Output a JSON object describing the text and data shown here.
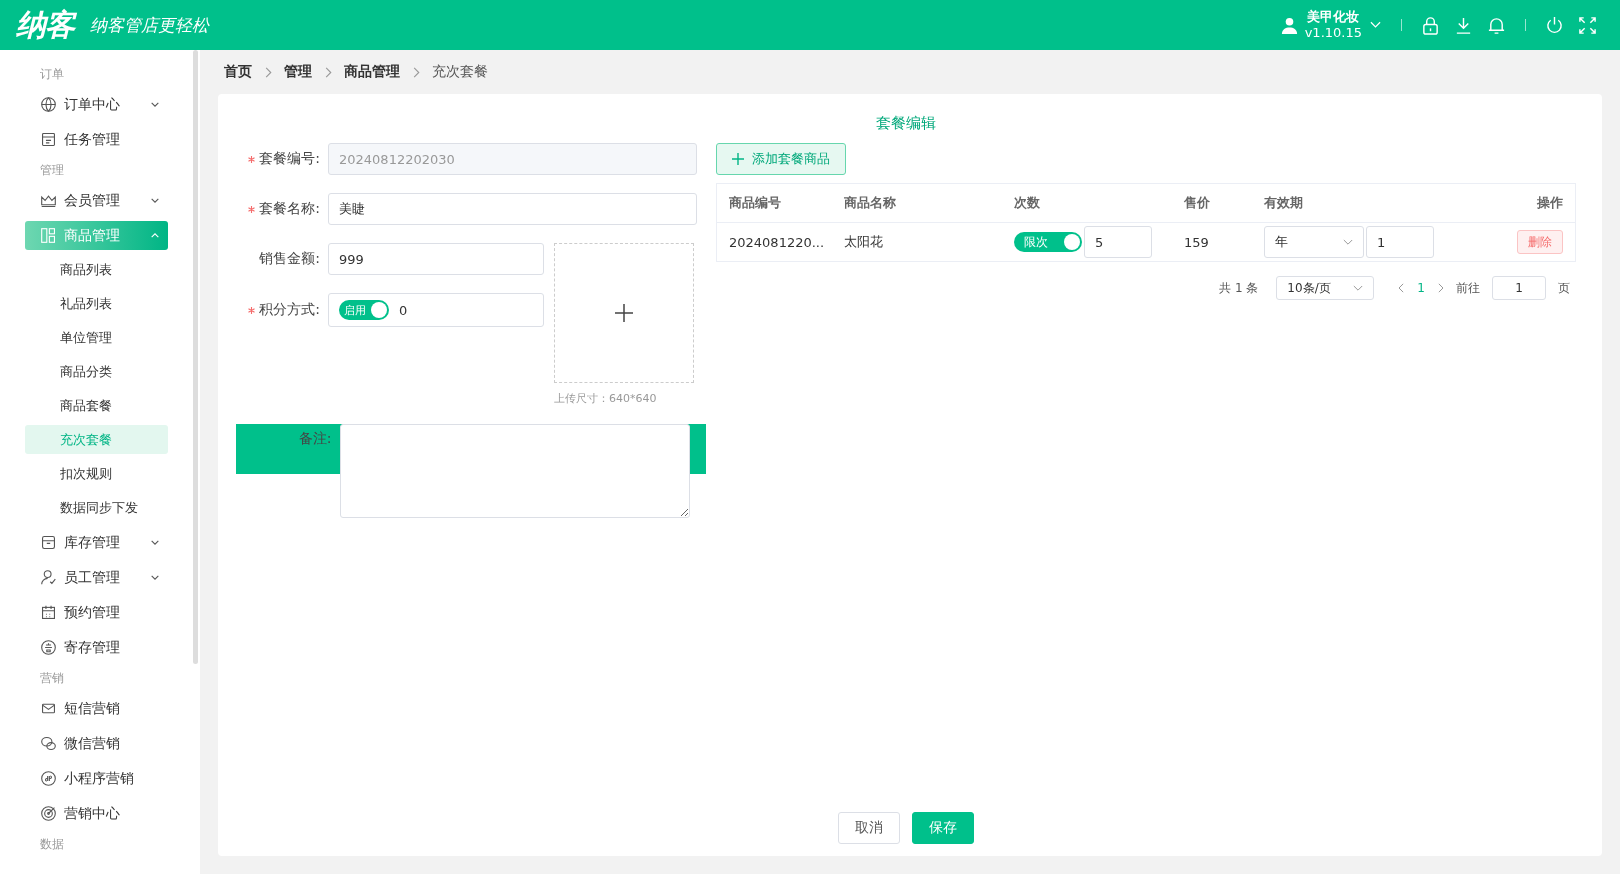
{
  "header": {
    "logo": "纳客",
    "slogan": "纳客管店更轻松",
    "user": "美甲化妆",
    "version": "v1.10.15"
  },
  "sidebar": {
    "sections": [
      {
        "label": "订单",
        "items": [
          {
            "label": "订单中心",
            "expanded": false,
            "selected": false
          },
          {
            "label": "任务管理",
            "selected": false
          }
        ]
      },
      {
        "label": "管理",
        "items": [
          {
            "label": "会员管理",
            "expanded": false,
            "selected": false
          },
          {
            "label": "商品管理",
            "expanded": true,
            "selected": true,
            "children": [
              {
                "label": "商品列表",
                "selected": false
              },
              {
                "label": "礼品列表",
                "selected": false
              },
              {
                "label": "单位管理",
                "selected": false
              },
              {
                "label": "商品分类",
                "selected": false
              },
              {
                "label": "商品套餐",
                "selected": false
              },
              {
                "label": "充次套餐",
                "selected": true
              },
              {
                "label": "扣次规则",
                "selected": false
              },
              {
                "label": "数据同步下发",
                "selected": false
              }
            ]
          },
          {
            "label": "库存管理",
            "expanded": false,
            "selected": false
          },
          {
            "label": "员工管理",
            "expanded": false,
            "selected": false
          },
          {
            "label": "预约管理",
            "selected": false
          },
          {
            "label": "寄存管理",
            "selected": false
          }
        ]
      },
      {
        "label": "营销",
        "items": [
          {
            "label": "短信营销",
            "selected": false
          },
          {
            "label": "微信营销",
            "selected": false
          },
          {
            "label": "小程序营销",
            "selected": false
          },
          {
            "label": "营销中心",
            "selected": false
          }
        ]
      },
      {
        "label": "数据"
      }
    ]
  },
  "breadcrumb": [
    {
      "label": "首页",
      "current": false
    },
    {
      "label": "管理",
      "current": false
    },
    {
      "label": "商品管理",
      "current": false
    },
    {
      "label": "充次套餐",
      "current": true
    }
  ],
  "title": "套餐编辑",
  "form": {
    "code": {
      "label": "套餐编号:",
      "required": true,
      "value": "20240812202030",
      "disabled": true
    },
    "name": {
      "label": "套餐名称:",
      "required": true,
      "value": "美睫"
    },
    "amount": {
      "label": "销售金额:",
      "required": false,
      "value": "999"
    },
    "points": {
      "label": "积分方式:",
      "required": true,
      "switch_label": "启用",
      "on": true,
      "value": "0"
    },
    "upload_hint": "上传尺寸：640*640",
    "remark": {
      "label": "备注:",
      "required": false
    }
  },
  "add_button": "添加套餐商品",
  "table": {
    "columns": [
      "商品编号",
      "商品名称",
      "次数",
      "售价",
      "有效期",
      "操作"
    ],
    "rows": [
      {
        "code": "2024081220...",
        "name": "太阳花",
        "limit": {
          "label": "限次",
          "on": true
        },
        "count": "5",
        "price": "159",
        "period_unit": "年",
        "period_value": "1",
        "action": "删除"
      }
    ]
  },
  "pagination": {
    "total": "共 1 条",
    "page_size": "10条/页",
    "pages": [
      {
        "label": "1",
        "selected": true
      }
    ],
    "goto_label": "前往",
    "goto_value": "1",
    "suffix": "页"
  },
  "buttons": [
    {
      "label": "取消",
      "kind": "secondary"
    },
    {
      "label": "保存",
      "kind": "primary"
    }
  ]
}
